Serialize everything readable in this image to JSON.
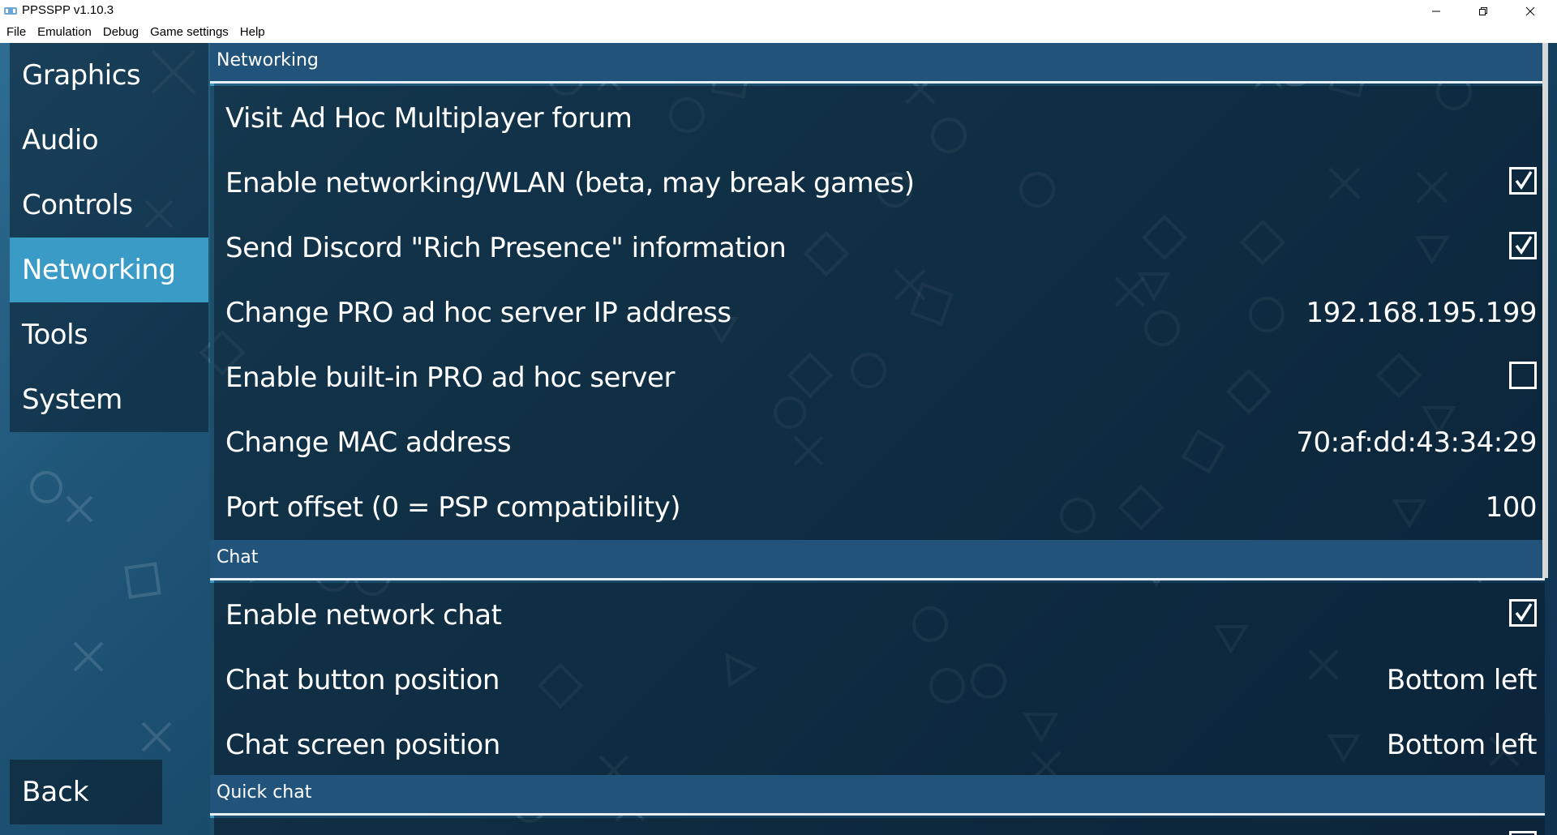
{
  "window": {
    "title": "PPSSPP v1.10.3"
  },
  "menu": [
    "File",
    "Emulation",
    "Debug",
    "Game settings",
    "Help"
  ],
  "nav": {
    "items": [
      {
        "label": "Graphics"
      },
      {
        "label": "Audio"
      },
      {
        "label": "Controls"
      },
      {
        "label": "Networking",
        "active": true
      },
      {
        "label": "Tools"
      },
      {
        "label": "System"
      }
    ],
    "back_label": "Back"
  },
  "sections": {
    "networking": {
      "title": "Networking",
      "rows": [
        {
          "label": "Visit Ad Hoc Multiplayer forum"
        },
        {
          "label": "Enable networking/WLAN (beta, may break games)",
          "checked": true
        },
        {
          "label": "Send Discord \"Rich Presence\" information",
          "checked": true
        },
        {
          "label": "Change PRO ad hoc server IP address",
          "value": "192.168.195.199"
        },
        {
          "label": "Enable built-in PRO ad hoc server",
          "checked": false
        },
        {
          "label": "Change MAC address",
          "value": "70:af:dd:43:34:29"
        },
        {
          "label": "Port offset (0 = PSP compatibility)",
          "value": "100"
        }
      ]
    },
    "chat": {
      "title": "Chat",
      "rows": [
        {
          "label": "Enable network chat",
          "checked": true
        },
        {
          "label": "Chat button position",
          "value": "Bottom left"
        },
        {
          "label": "Chat screen position",
          "value": "Bottom left"
        }
      ]
    },
    "quick_chat": {
      "title": "Quick chat"
    }
  },
  "colors": {
    "accent": "#3a9bc6",
    "background_light": "#2e6d93",
    "background_dark": "#0f3150",
    "section_header": "#22537a"
  }
}
